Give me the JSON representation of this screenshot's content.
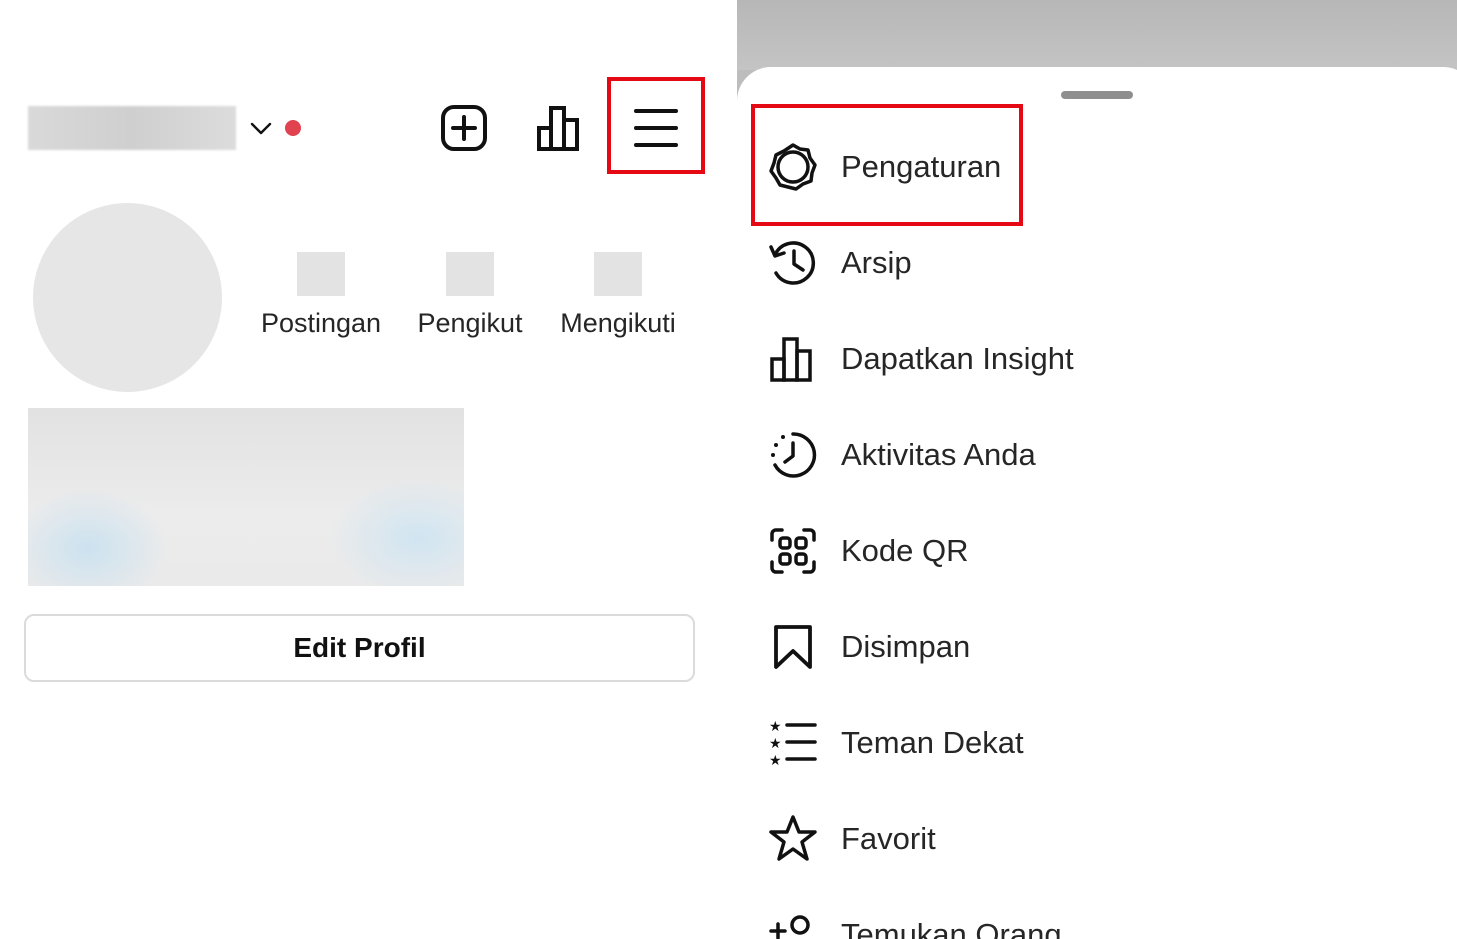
{
  "profile": {
    "stats": [
      {
        "label": "Postingan"
      },
      {
        "label": "Pengikut"
      },
      {
        "label": "Mengikuti"
      }
    ],
    "edit_button_label": "Edit Profil"
  },
  "header": {
    "icons": [
      "chevron-down-icon",
      "new-post-icon",
      "insights-icon",
      "hamburger-menu-icon"
    ],
    "notification_color": "#e0434f"
  },
  "menu": {
    "items": [
      {
        "label": "Pengaturan",
        "icon": "settings-icon"
      },
      {
        "label": "Arsip",
        "icon": "archive-icon"
      },
      {
        "label": "Dapatkan Insight",
        "icon": "insights-icon"
      },
      {
        "label": "Aktivitas Anda",
        "icon": "activity-icon"
      },
      {
        "label": "Kode QR",
        "icon": "qr-code-icon"
      },
      {
        "label": "Disimpan",
        "icon": "bookmark-icon"
      },
      {
        "label": "Teman Dekat",
        "icon": "close-friends-icon"
      },
      {
        "label": "Favorit",
        "icon": "star-icon"
      },
      {
        "label": "Temukan Orang",
        "icon": "add-person-icon"
      }
    ]
  },
  "highlight_color": "#e50914"
}
